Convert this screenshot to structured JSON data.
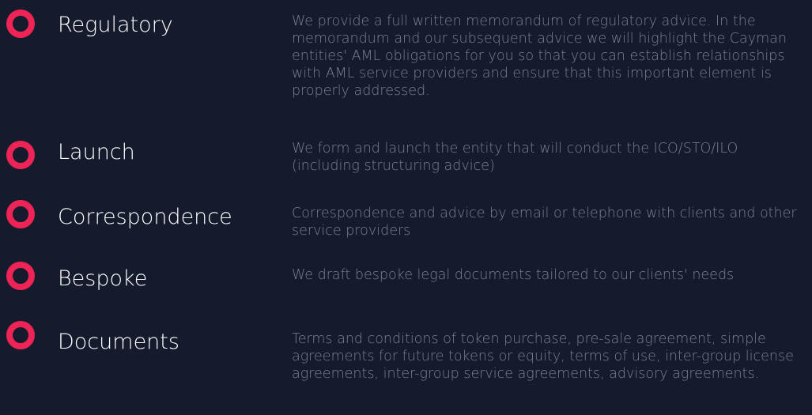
{
  "colors": {
    "background": "#151a2c",
    "accent": "#ee2456",
    "title": "#ffffff",
    "description": "#7a8094"
  },
  "services": [
    {
      "icon": "ring-icon",
      "title": "Regulatory",
      "description": "We provide a full written memorandum of regulatory advice. In the memorandum and our subsequent advice we will highlight the Cayman entities' AML obligations for you so that you can establish relationships with AML service providers and ensure that this important element is properly addressed."
    },
    {
      "icon": "ring-icon",
      "title": "Launch",
      "description": "We form and launch the entity that will conduct the ICO/STO/ILO (including structuring advice)"
    },
    {
      "icon": "ring-icon",
      "title": "Correspondence",
      "description": "Correspondence and advice by email or telephone with clients and other service providers"
    },
    {
      "icon": "ring-icon",
      "title": "Bespoke",
      "description": "We draft bespoke legal documents tailored to our clients' needs"
    },
    {
      "icon": "ring-icon",
      "title": "Documents",
      "description": "Terms and conditions of token purchase, pre-sale agreement, simple agreements for future tokens or equity, terms of use, inter-group license agreements, inter-group service agreements, advisory agreements."
    }
  ]
}
